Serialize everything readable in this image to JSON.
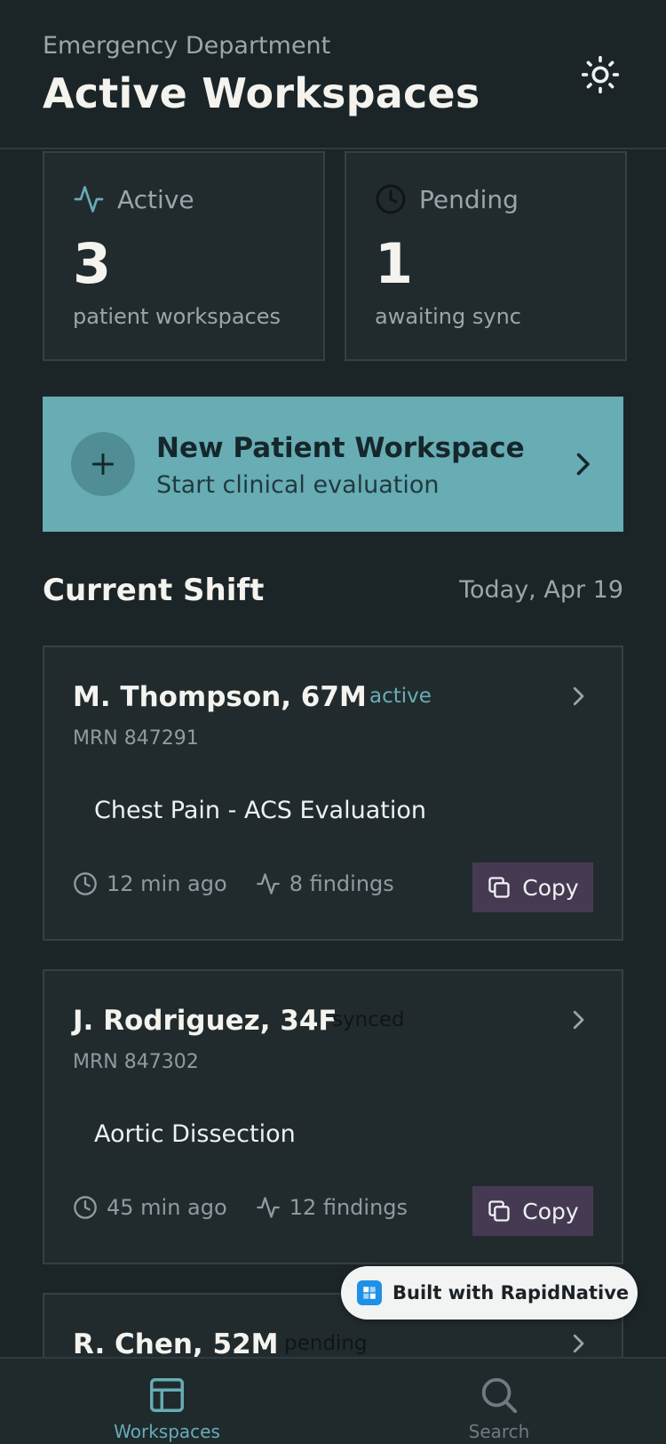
{
  "header": {
    "subtitle": "Emergency Department",
    "title": "Active Workspaces"
  },
  "stats": [
    {
      "label": "Active",
      "value": "3",
      "sub": "patient workspaces",
      "icon": "activity-icon"
    },
    {
      "label": "Pending",
      "value": "1",
      "sub": "awaiting sync",
      "icon": "clock-icon"
    }
  ],
  "new_workspace": {
    "title": "New Patient Workspace",
    "subtitle": "Start clinical evaluation"
  },
  "section": {
    "title": "Current Shift",
    "date": "Today, Apr 19"
  },
  "patients": [
    {
      "name": "M. Thompson, 67M",
      "status": "active",
      "mrn": "MRN 847291",
      "complaint": "Chest Pain - ACS Evaluation",
      "time": "12 min ago",
      "findings": "8 findings",
      "copy": "Copy"
    },
    {
      "name": "J. Rodriguez, 34F",
      "status": "synced",
      "mrn": "MRN 847302",
      "complaint": "Aortic Dissection",
      "time": "45 min ago",
      "findings": "12 findings",
      "copy": "Copy"
    },
    {
      "name": "R. Chen, 52M",
      "status": "pending"
    }
  ],
  "badge": {
    "text": "Built with RapidNative"
  },
  "tabs": [
    {
      "label": "Workspaces",
      "icon": "layout-icon",
      "active": true
    },
    {
      "label": "Search",
      "icon": "search-icon",
      "active": false
    }
  ],
  "colors": {
    "background": "#1b2528",
    "card": "#212b2e",
    "accent": "#68acb4",
    "copy_button": "#463a52",
    "status_active": "#68acb4"
  }
}
